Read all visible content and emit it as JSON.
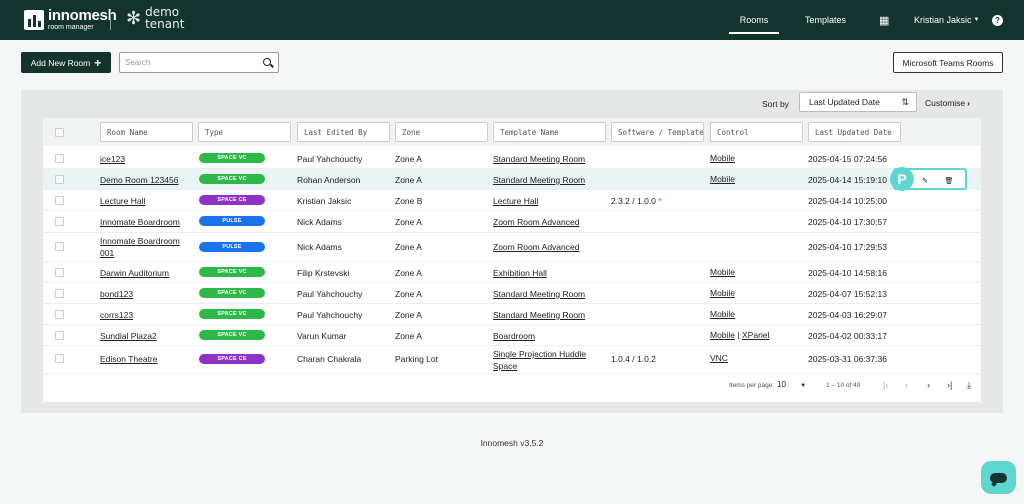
{
  "header": {
    "logo_name": "innomesh",
    "logo_sub": "room manager",
    "tenant": "demo tenant",
    "nav": {
      "rooms": "Rooms",
      "templates": "Templates",
      "user": "Kristian Jaksic",
      "help": "?"
    }
  },
  "toolbar": {
    "add_label": "Add New Room",
    "search_placeholder": "Search",
    "teams_label": "Microsoft Teams Rooms"
  },
  "sort": {
    "label": "Sort by",
    "value": "Last Updated Date",
    "customise": "Customise"
  },
  "columns": [
    "Room Name",
    "Type",
    "Last Edited By",
    "Zone",
    "Template Name",
    "Software / Template",
    "Control",
    "Last Updated Date"
  ],
  "badge_colors": {
    "SPACE VC": "#2eb84a",
    "PULSE": "#1a73e8",
    "SPACE CE": "#8e33c4"
  },
  "rows": [
    {
      "name": "ice123",
      "type": "SPACE VC",
      "editor": "Paul Yahchouchy",
      "zone": "Zone A",
      "template": "Standard Meeting Room",
      "software": "",
      "control": "Mobile",
      "control2": "",
      "date": "2025-04-15 07:24:56"
    },
    {
      "name": "Demo Room 123456",
      "type": "SPACE VC",
      "editor": "Rohan Anderson",
      "zone": "Zone A",
      "template": "Standard Meeting Room",
      "software": "",
      "control": "Mobile",
      "control2": "",
      "date": "2025-04-14 15:19:10"
    },
    {
      "name": "Lecture Hall",
      "type": "SPACE CE",
      "editor": "Kristian Jaksic",
      "zone": "Zone B",
      "template": "Lecture Hall",
      "software": "2.3.2 / 1.0.0",
      "control": "",
      "control2": "",
      "date": "2025-04-14 10:25:00"
    },
    {
      "name": "Innomate Boardroom",
      "type": "PULSE",
      "editor": "Nick Adams",
      "zone": "Zone A",
      "template": "Zoom Room Advanced",
      "software": "",
      "control": "",
      "control2": "",
      "date": "2025-04-10 17:30:57"
    },
    {
      "name": "Innomate Boardroom 001",
      "type": "PULSE",
      "editor": "Nick Adams",
      "zone": "Zone A",
      "template": "Zoom Room Advanced",
      "software": "",
      "control": "",
      "control2": "",
      "date": "2025-04-10 17:29:53"
    },
    {
      "name": "Darwin Auditorium",
      "type": "SPACE VC",
      "editor": "Filip Krstevski",
      "zone": "Zone A",
      "template": "Exhibition Hall",
      "software": "",
      "control": "Mobile",
      "control2": "",
      "date": "2025-04-10 14:58:16"
    },
    {
      "name": "bond123",
      "type": "SPACE VC",
      "editor": "Paul Yahchouchy",
      "zone": "Zone A",
      "template": "Standard Meeting Room",
      "software": "",
      "control": "Mobile",
      "control2": "",
      "date": "2025-04-07 15:52:13"
    },
    {
      "name": "corrs123",
      "type": "SPACE VC",
      "editor": "Paul Yahchouchy",
      "zone": "Zone A",
      "template": "Standard Meeting Room",
      "software": "",
      "control": "Mobile",
      "control2": "",
      "date": "2025-04-03 16:29:07"
    },
    {
      "name": "Sundial Plaza2",
      "type": "SPACE VC",
      "editor": "Varun Kumar",
      "zone": "Zone A",
      "template": "Boardroom",
      "software": "",
      "control": "Mobile",
      "control2": "XPanel",
      "date": "2025-04-02 00:33:17"
    },
    {
      "name": "Edison Theatre",
      "type": "SPACE CE",
      "editor": "Charan Chakrala",
      "zone": "Parking Lot",
      "template": "Single Projection Huddle Space",
      "software": "1.0.4 / 1.0.2",
      "control": "VNC",
      "control2": "",
      "date": "2025-03-31 06:37:36"
    }
  ],
  "hover": {
    "avatar": "P"
  },
  "pagination": {
    "label": "Items per page:",
    "size": "10",
    "range": "1 – 10 of 49"
  },
  "footer": "Innomesh v3.5.2"
}
